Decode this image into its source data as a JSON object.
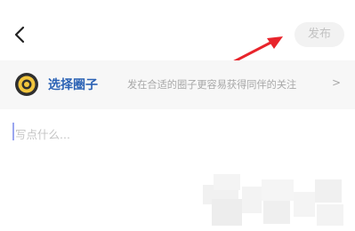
{
  "header": {
    "back_icon": "chevron-left-icon",
    "publish_label": "发布",
    "publish_state": "disabled"
  },
  "circle_selector": {
    "icon": "circle-icon",
    "title": "选择圈子",
    "hint": "发在合适的圈子更容易获得同伴的关注",
    "chevron": ">"
  },
  "composer": {
    "placeholder": "写点什么..."
  },
  "colors": {
    "accent": "#2b62b5",
    "icon_yellow": "#f2c53d",
    "annotation_arrow": "#e8242b"
  }
}
